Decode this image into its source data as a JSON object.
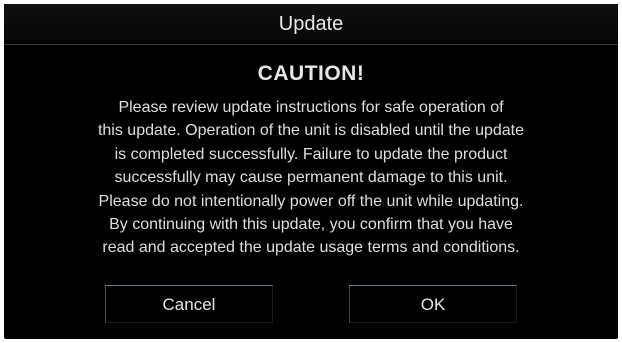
{
  "dialog": {
    "title": "Update",
    "heading": "CAUTION!",
    "message_lines": [
      "Please review update instructions for safe operation of",
      "this update.  Operation of the unit is disabled until the update",
      "is completed successfully.  Failure to update the product",
      "successfully may cause permanent damage to this unit.",
      "Please do not intentionally power off the unit while updating.",
      "By continuing with this update, you confirm that you have",
      "read and accepted the update usage terms and conditions."
    ],
    "buttons": {
      "cancel": "Cancel",
      "ok": "OK"
    }
  }
}
